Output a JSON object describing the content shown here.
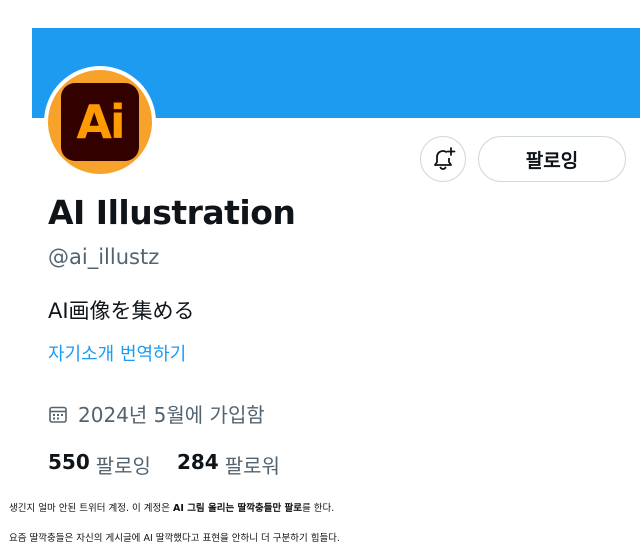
{
  "banner": {
    "color": "#1d9bf0"
  },
  "avatar": {
    "text": "Ai",
    "background": "#f7a22a",
    "tile_color": "#330000",
    "text_color": "#ff9a00"
  },
  "actions": {
    "notify_icon": "bell-plus-icon",
    "follow_label": "팔로잉"
  },
  "profile": {
    "display_name": "AI Illustration",
    "handle": "@ai_illustz",
    "bio": "AI画像を集める",
    "translate_link": "자기소개 번역하기",
    "joined_icon": "calendar-icon",
    "joined": "2024년 5월에 가입함"
  },
  "stats": {
    "following_count": "550",
    "following_label": "팔로잉",
    "followers_count": "284",
    "followers_label": "팔로워"
  },
  "caption": {
    "line1_part1": "생긴지 얼마 안된 트위터 계정. 이 계정은 ",
    "line1_bold1": "AI 그림 올리는 딸깍충들만 팔로",
    "line1_part2": "를 한다.",
    "line2": "요즘 딸깍충들은 자신의 게시글에 AI 딸깍했다고 표현을 안하니 더 구분하기 힘들다."
  }
}
